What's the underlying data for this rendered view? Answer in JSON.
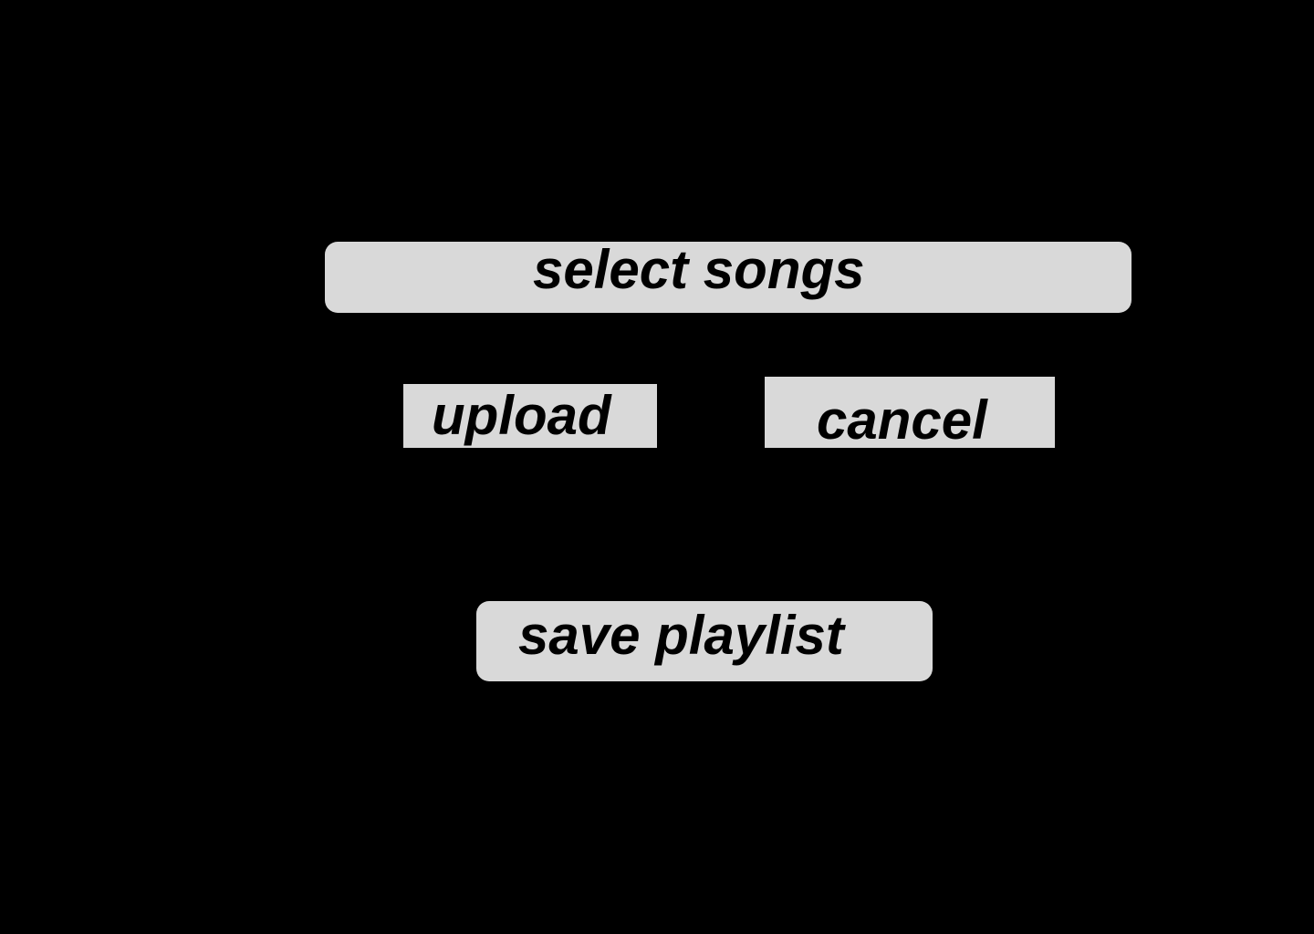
{
  "screen": {
    "background_color": "#000000",
    "button_color": "#d9d9d9",
    "text_color": "#000000"
  },
  "buttons": {
    "select_songs": "select songs",
    "upload": "upload",
    "cancel": "cancel",
    "save_playlist": "save playlist"
  }
}
